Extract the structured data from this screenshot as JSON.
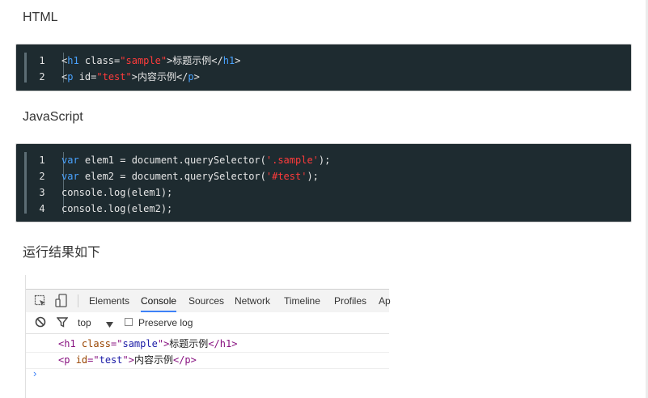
{
  "headings": {
    "html": "HTML",
    "js": "JavaScript",
    "result": "运行结果如下"
  },
  "html_code": [
    {
      "num": "1",
      "parts": [
        {
          "t": "<",
          "c": "plain"
        },
        {
          "t": "h1",
          "c": "tag"
        },
        {
          "t": " class=",
          "c": "plain"
        },
        {
          "t": "\"sample\"",
          "c": "str"
        },
        {
          "t": ">标题示例</",
          "c": "plain"
        },
        {
          "t": "h1",
          "c": "tag"
        },
        {
          "t": ">",
          "c": "plain"
        }
      ]
    },
    {
      "num": "2",
      "parts": [
        {
          "t": "<",
          "c": "plain"
        },
        {
          "t": "p",
          "c": "tag"
        },
        {
          "t": " id=",
          "c": "plain"
        },
        {
          "t": "\"test\"",
          "c": "str"
        },
        {
          "t": ">内容示例</",
          "c": "plain"
        },
        {
          "t": "p",
          "c": "tag"
        },
        {
          "t": ">",
          "c": "plain"
        }
      ]
    }
  ],
  "js_code": [
    {
      "num": "1",
      "parts": [
        {
          "t": "var",
          "c": "kw"
        },
        {
          "t": " elem1 = document.querySelector(",
          "c": "plain"
        },
        {
          "t": "'.sample'",
          "c": "str"
        },
        {
          "t": ");",
          "c": "plain"
        }
      ]
    },
    {
      "num": "2",
      "parts": [
        {
          "t": "var",
          "c": "kw"
        },
        {
          "t": " elem2 = document.querySelector(",
          "c": "plain"
        },
        {
          "t": "'#test'",
          "c": "str"
        },
        {
          "t": ");",
          "c": "plain"
        }
      ]
    },
    {
      "num": "3",
      "parts": [
        {
          "t": "console.log(elem1);",
          "c": "plain"
        }
      ]
    },
    {
      "num": "4",
      "parts": [
        {
          "t": "console.log(elem2);",
          "c": "plain"
        }
      ]
    }
  ],
  "devtools": {
    "tabs": [
      "Elements",
      "Console",
      "Sources",
      "Network",
      "Timeline",
      "Profiles",
      "Ap"
    ],
    "active_tab": "Console",
    "context": "top",
    "preserve_log": "Preserve log",
    "output": [
      {
        "parts": [
          {
            "t": "<h1 ",
            "c": "t-tag"
          },
          {
            "t": "class",
            "c": "t-attr"
          },
          {
            "t": "=\"",
            "c": "t-tag"
          },
          {
            "t": "sample",
            "c": "t-val"
          },
          {
            "t": "\">",
            "c": "t-tag"
          },
          {
            "t": "标题示例",
            "c": "t-text"
          },
          {
            "t": "</h1>",
            "c": "t-tag"
          }
        ]
      },
      {
        "parts": [
          {
            "t": "<p ",
            "c": "t-tag"
          },
          {
            "t": "id",
            "c": "t-attr"
          },
          {
            "t": "=\"",
            "c": "t-tag"
          },
          {
            "t": "test",
            "c": "t-val"
          },
          {
            "t": "\">",
            "c": "t-tag"
          },
          {
            "t": "内容示例",
            "c": "t-text"
          },
          {
            "t": "</p>",
            "c": "t-tag"
          }
        ]
      }
    ],
    "prompt_symbol": "›"
  }
}
